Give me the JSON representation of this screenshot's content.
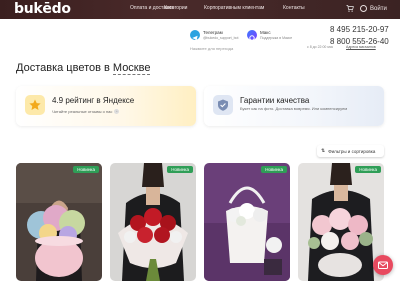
{
  "header": {
    "logo": "bukēdo",
    "nav": [
      "Оплата и доставка",
      "Категории",
      "Корпоративным клиентам",
      "Контакты"
    ],
    "login_label": "Войти"
  },
  "contacts": {
    "telegram": {
      "title": "Телеграм",
      "handle": "@bukedo_support_bot",
      "hint": "Нажмите для перехода"
    },
    "max": {
      "title": "Макс",
      "subtitle": "Поддержка в Максе"
    },
    "phone1": "8 495 215-20-97",
    "phone2": "8 800 555-26-40",
    "hours": "с 8 до 22:00 мск",
    "address": "Адреса магазинов"
  },
  "page": {
    "title_prefix": "Доставка цветов в ",
    "city": "Москве"
  },
  "cards": {
    "rating": {
      "title": "4.9 рейтинг в Яндексе",
      "subtitle": "Читайте реальные отзывы о нас",
      "arrow": "›"
    },
    "guarantee": {
      "title": "Гарантии качества",
      "subtitle": "Букет как на фото. Доставка вовремя. Или компенсируем"
    }
  },
  "filters": {
    "icon": "⇅",
    "label": "Фильтры и сортировка"
  },
  "products": [
    {
      "badge": "Новинка"
    },
    {
      "badge": "Новинка"
    },
    {
      "badge": "Новинка"
    },
    {
      "badge": "Новинка"
    }
  ],
  "colors": {
    "accent": "#e84a5f",
    "badge": "#2f9e57",
    "topbar": "#3a1f1f"
  }
}
